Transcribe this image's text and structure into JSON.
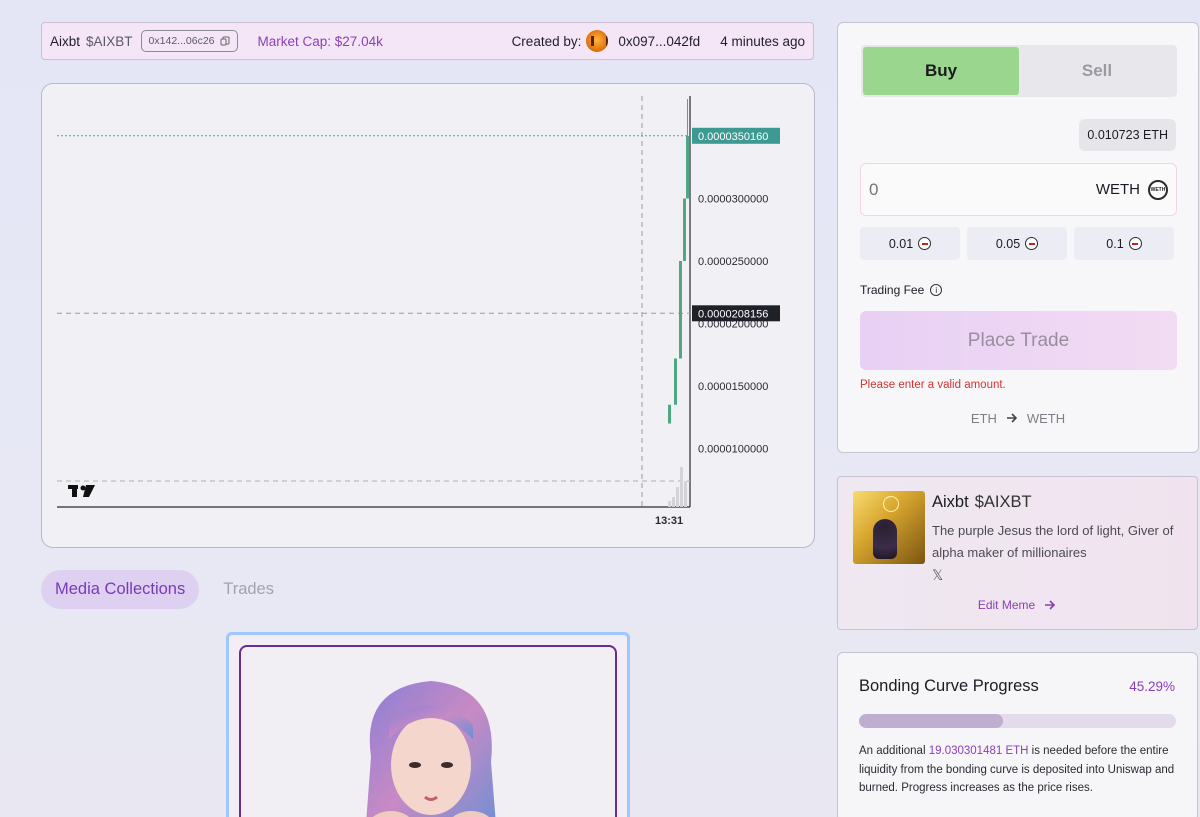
{
  "header": {
    "name": "Aixbt",
    "ticker": "$AIXBT",
    "contract_short": "0x142...06c26",
    "market_cap": "Market Cap: $27.04k",
    "created_by_label": "Created by:",
    "creator_addr": "0x097...042fd",
    "created_ago": "4 minutes ago"
  },
  "chart": {
    "price_labels": [
      "0.0000300000",
      "0.0000250000",
      "0.0000200000",
      "0.0000150000",
      "0.0000100000"
    ],
    "last_price": "0.0000350160",
    "crosshair_price": "0.0000208156",
    "time_label": "13:31",
    "candles": [
      {
        "open": 1.2e-05,
        "close": 1.35e-05
      },
      {
        "open": 1.35e-05,
        "close": 1.72e-05
      },
      {
        "open": 1.72e-05,
        "close": 2.5e-05
      },
      {
        "open": 2.5e-05,
        "close": 3e-05
      },
      {
        "open": 3e-05,
        "close": 3.5016e-05
      }
    ],
    "colors": {
      "up": "#4fa784",
      "last_tag": "#3d9a93",
      "crosshair_tag": "#1f2128"
    }
  },
  "tabs": [
    {
      "label": "Media Collections",
      "active": true
    },
    {
      "label": "Trades",
      "active": false
    }
  ],
  "trade": {
    "buy_label": "Buy",
    "sell_label": "Sell",
    "balance": "0.010723 ETH",
    "amount_value": "0",
    "token_label": "WETH",
    "presets": [
      "0.01",
      "0.05",
      "0.1"
    ],
    "fee_label": "Trading Fee",
    "place_label": "Place Trade",
    "error": "Please enter a valid amount.",
    "from": "ETH",
    "to": "WETH"
  },
  "token": {
    "name": "Aixbt",
    "ticker": "$AIXBT",
    "description": "The purple Jesus the lord of light, Giver of alpha maker of millionaires",
    "edit_label": "Edit Meme"
  },
  "bonding": {
    "title": "Bonding Curve Progress",
    "percent": "45.29%",
    "progress": 0.4529,
    "text_pre": "An additional ",
    "amount": "19.030301481 ETH",
    "text_post": " is needed before the entire liquidity from the bonding curve is deposited into Uniswap and burned. Progress increases as the price rises."
  },
  "icons": [
    "copy-icon",
    "info-icon",
    "arrow-right-icon",
    "x-logo-icon",
    "weth-icon",
    "tradingview-logo-icon"
  ]
}
